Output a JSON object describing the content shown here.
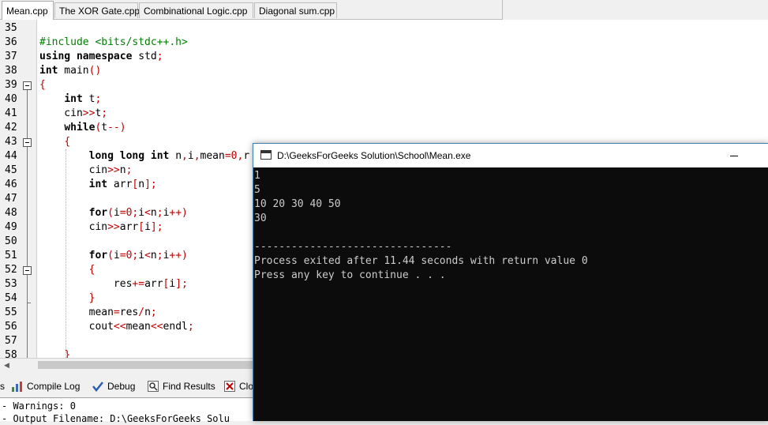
{
  "tabs": [
    "Mean.cpp",
    "The XOR Gate.cpp",
    "Combinational Logic.cpp",
    "Diagonal sum.cpp"
  ],
  "line_numbers": [
    "35",
    "36",
    "37",
    "38",
    "39",
    "40",
    "41",
    "42",
    "43",
    "44",
    "45",
    "46",
    "47",
    "48",
    "49",
    "50",
    "51",
    "52",
    "53",
    "54",
    "55",
    "56",
    "57",
    "58"
  ],
  "bottom_tabs": {
    "partial_left": "s",
    "compile_log": "Compile Log",
    "debug": "Debug",
    "find_results": "Find Results",
    "close_partial": "Clo"
  },
  "output_lines": [
    "- Warnings: 0",
    "- Output Filename: D:\\GeeksForGeeks Solu"
  ],
  "console": {
    "title": "D:\\GeeksForGeeks Solution\\School\\Mean.exe",
    "lines": [
      "1",
      "5",
      "10 20 30 40 50",
      "30",
      "",
      "--------------------------------",
      "Process exited after 11.44 seconds with return value 0",
      "Press any key to continue . . ."
    ]
  },
  "colors": {
    "keyword": "#000000",
    "operator": "#c00000",
    "preprocessor": "#008000",
    "console_bg": "#0c0c0c",
    "console_text": "#cccccc"
  }
}
